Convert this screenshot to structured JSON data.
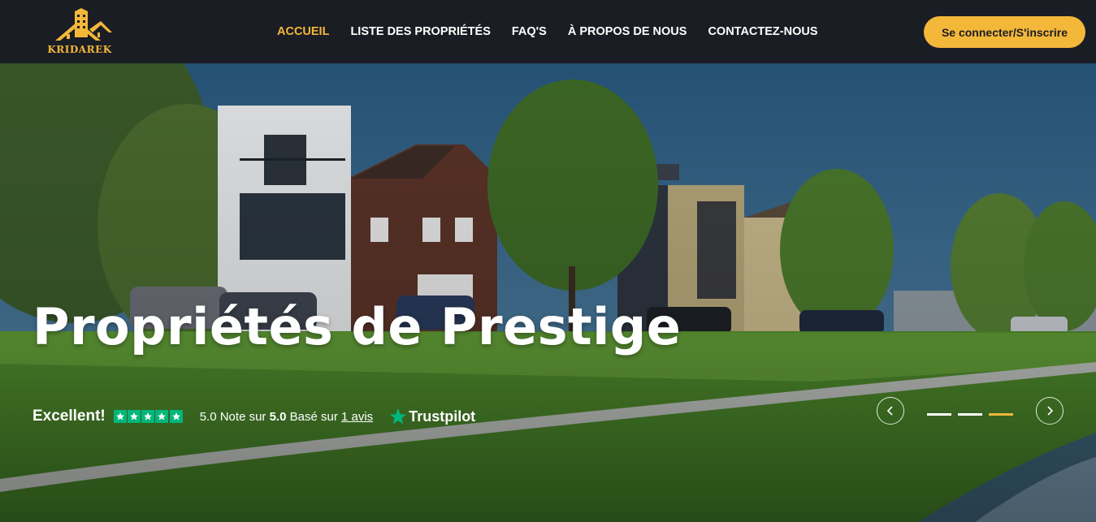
{
  "brand": {
    "name": "KRIDAREK",
    "color": "#f3b73a",
    "logo_icon": "house-building-icon"
  },
  "nav": {
    "items": [
      {
        "label": "ACCUEIL",
        "active": true
      },
      {
        "label": "LISTE DES PROPRIÉTÉS",
        "active": false
      },
      {
        "label": "FAQ'S",
        "active": false
      },
      {
        "label": "À PROPOS DE NOUS",
        "active": false
      },
      {
        "label": "CONTACTEZ-NOUS",
        "active": false
      }
    ],
    "login_label": "Se connecter/S'inscrire"
  },
  "hero": {
    "title": "Propriétés de Prestige",
    "slider": {
      "slides": 3,
      "active_index": 2,
      "prev_icon": "chevron-left-icon",
      "next_icon": "chevron-right-icon"
    }
  },
  "trustpilot": {
    "excellent": "Excellent!",
    "stars": 5,
    "note_prefix": "5.0 Note sur",
    "note_value": "5.0",
    "based_on": "Basé sur",
    "reviews": "1 avis",
    "brand": "Trustpilot",
    "star_color": "#00b67a"
  },
  "colors": {
    "header_bg": "#1b1d24",
    "accent": "#f3b73a"
  }
}
